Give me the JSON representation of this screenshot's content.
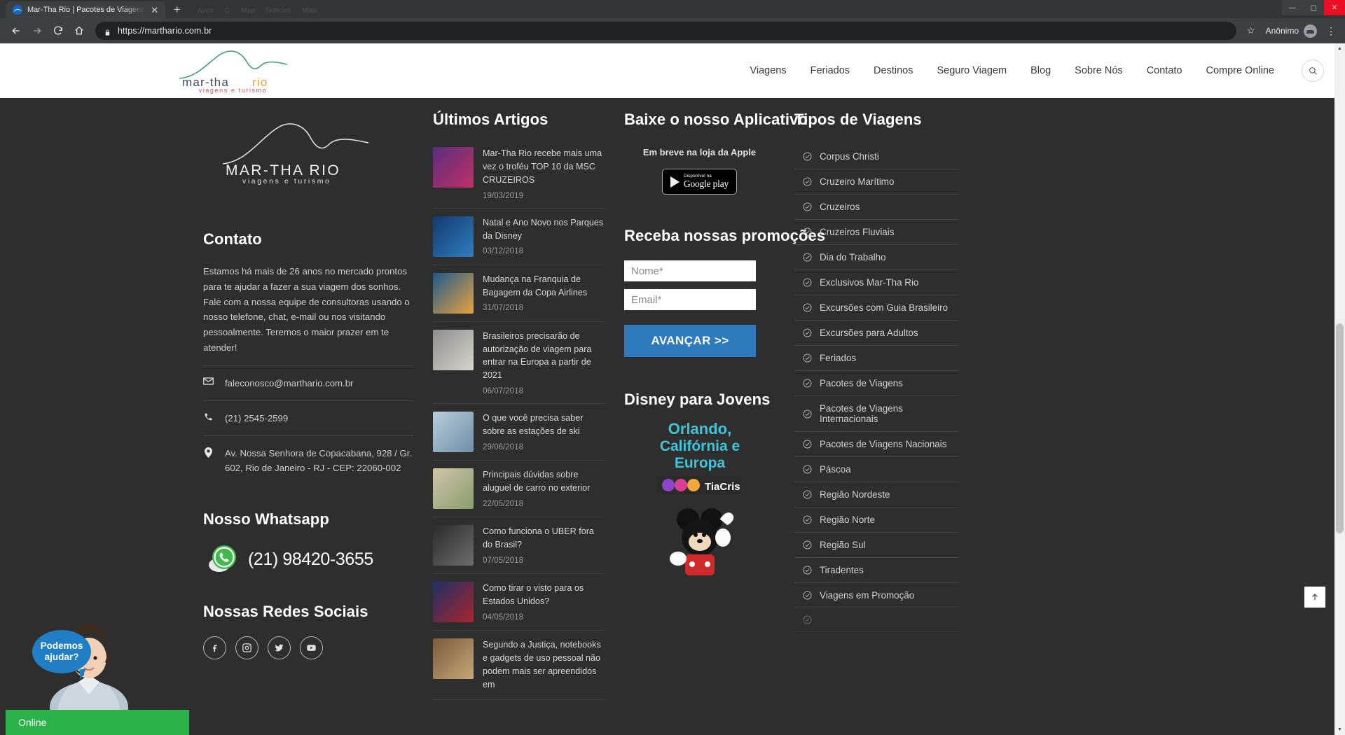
{
  "browser": {
    "tab_title": "Mar-Tha Rio | Pacotes de Viagens",
    "tab_close": "✕",
    "new_tab": "+",
    "ghost_tabs": [
      "Apps",
      "G",
      "Map",
      "Noticias",
      "Mais"
    ],
    "url": "https://marthario.com.br",
    "profile_label": "Anônimo",
    "win_min": "—",
    "win_max": "▢",
    "win_close": "✕"
  },
  "header": {
    "logo_line1": "MAR-THA RIO",
    "logo_line2": "viagens e turismo",
    "nav": [
      {
        "label": "Viagens"
      },
      {
        "label": "Feriados"
      },
      {
        "label": "Destinos"
      },
      {
        "label": "Seguro Viagem"
      },
      {
        "label": "Blog"
      },
      {
        "label": "Sobre Nós"
      },
      {
        "label": "Contato"
      },
      {
        "label": "Compre Online"
      }
    ]
  },
  "footer": {
    "logo_line1": "MAR-THA RIO",
    "logo_line2": "viagens e turismo",
    "contato": {
      "heading": "Contato",
      "paragraph": "Estamos há mais de 26 anos no mercado prontos para te ajudar a fazer a sua viagem dos sonhos. Fale com a nossa equipe de consultoras usando o nosso telefone, chat, e-mail ou nos visitando pessoalmente. Teremos o maior prazer em te atender!",
      "email": "faleconosco@marthario.com.br",
      "phone": "(21) 2545-2599",
      "address": "Av. Nossa Senhora de Copacabana, 928 / Gr. 602, Rio de Janeiro - RJ - CEP: 22060-002"
    },
    "whatsapp": {
      "heading": "Nosso Whatsapp",
      "number": "(21) 98420-3655"
    },
    "social": {
      "heading": "Nossas Redes Sociais",
      "items": [
        {
          "name": "facebook"
        },
        {
          "name": "instagram"
        },
        {
          "name": "twitter"
        },
        {
          "name": "youtube"
        }
      ]
    },
    "articles": {
      "heading": "Últimos Artigos",
      "items": [
        {
          "title": "Mar-Tha Rio recebe mais uma vez o troféu TOP 10 da MSC CRUZEIROS",
          "date": "19/03/2019",
          "thumb_colors": [
            "#5b2d7a",
            "#c0306a"
          ]
        },
        {
          "title": "Natal e Ano Novo nos Parques da Disney",
          "date": "03/12/2018",
          "thumb_colors": [
            "#123a6b",
            "#2f7ec2"
          ]
        },
        {
          "title": "Mudança na Franquia de Bagagem da Copa Airlines",
          "date": "31/07/2018",
          "thumb_colors": [
            "#1d5a8a",
            "#e8a33d"
          ]
        },
        {
          "title": "Brasileiros precisarão de autorização de viagem para entrar na Europa a partir de 2021",
          "date": "06/07/2018",
          "thumb_colors": [
            "#8e8d8a",
            "#d8d5cf"
          ]
        },
        {
          "title": "O que você precisa saber sobre as estações de ski",
          "date": "29/06/2018",
          "thumb_colors": [
            "#b9cddb",
            "#6e8ea6"
          ]
        },
        {
          "title": "Principais dúvidas sobre aluguel de carro no exterior",
          "date": "22/05/2018",
          "thumb_colors": [
            "#cfc6a8",
            "#8a9c6d"
          ]
        },
        {
          "title": "Como funciona o UBER fora do Brasil?",
          "date": "07/05/2018",
          "thumb_colors": [
            "#2b2b2b",
            "#6d6d6d"
          ]
        },
        {
          "title": "Como tirar o visto para os Estados Unidos?",
          "date": "04/05/2018",
          "thumb_colors": [
            "#1d3064",
            "#a8252f"
          ]
        },
        {
          "title": "Segundo a Justiça, notebooks e gadgets de uso pessoal não podem mais ser apreendidos em",
          "date": "",
          "thumb_colors": [
            "#7a5a3a",
            "#c8a878"
          ]
        }
      ]
    },
    "app": {
      "heading": "Baixe o nosso Aplicativo",
      "apple_note": "Em breve na loja da Apple",
      "gplay_small": "Disponível na",
      "gplay_big": "Google play"
    },
    "promo": {
      "heading": "Receba nossas promoções",
      "name_placeholder": "Nome*",
      "name_value": "",
      "email_placeholder": "Email*",
      "email_value": "",
      "submit_label": "AVANÇAR >>",
      "submit_color": "#2f79bd"
    },
    "disney": {
      "heading": "Disney para Jovens",
      "art_line1": "Orlando,",
      "art_line2": "Califórnia e",
      "art_line3": "Europa",
      "brand": "TiaCris"
    },
    "types": {
      "heading": "Tipos de Viagens",
      "items": [
        {
          "label": "Corpus Christi"
        },
        {
          "label": "Cruzeiro Marítimo"
        },
        {
          "label": "Cruzeiros"
        },
        {
          "label": "Cruzeiros Fluviais"
        },
        {
          "label": "Dia do Trabalho"
        },
        {
          "label": "Exclusivos Mar-Tha Rio"
        },
        {
          "label": "Excursões com Guia Brasileiro"
        },
        {
          "label": "Excursões para Adultos"
        },
        {
          "label": "Feriados"
        },
        {
          "label": "Pacotes de Viagens"
        },
        {
          "label": "Pacotes de Viagens Internacionais"
        },
        {
          "label": "Pacotes de Viagens Nacionais"
        },
        {
          "label": "Páscoa"
        },
        {
          "label": "Região Nordeste"
        },
        {
          "label": "Região Norte"
        },
        {
          "label": "Região Sul"
        },
        {
          "label": "Tiradentes"
        },
        {
          "label": "Viagens em Promoção"
        }
      ]
    }
  },
  "chat": {
    "bubble_line1": "Podemos",
    "bubble_line2": "ajudar?",
    "status": "Online",
    "status_color": "#2bb24a"
  }
}
